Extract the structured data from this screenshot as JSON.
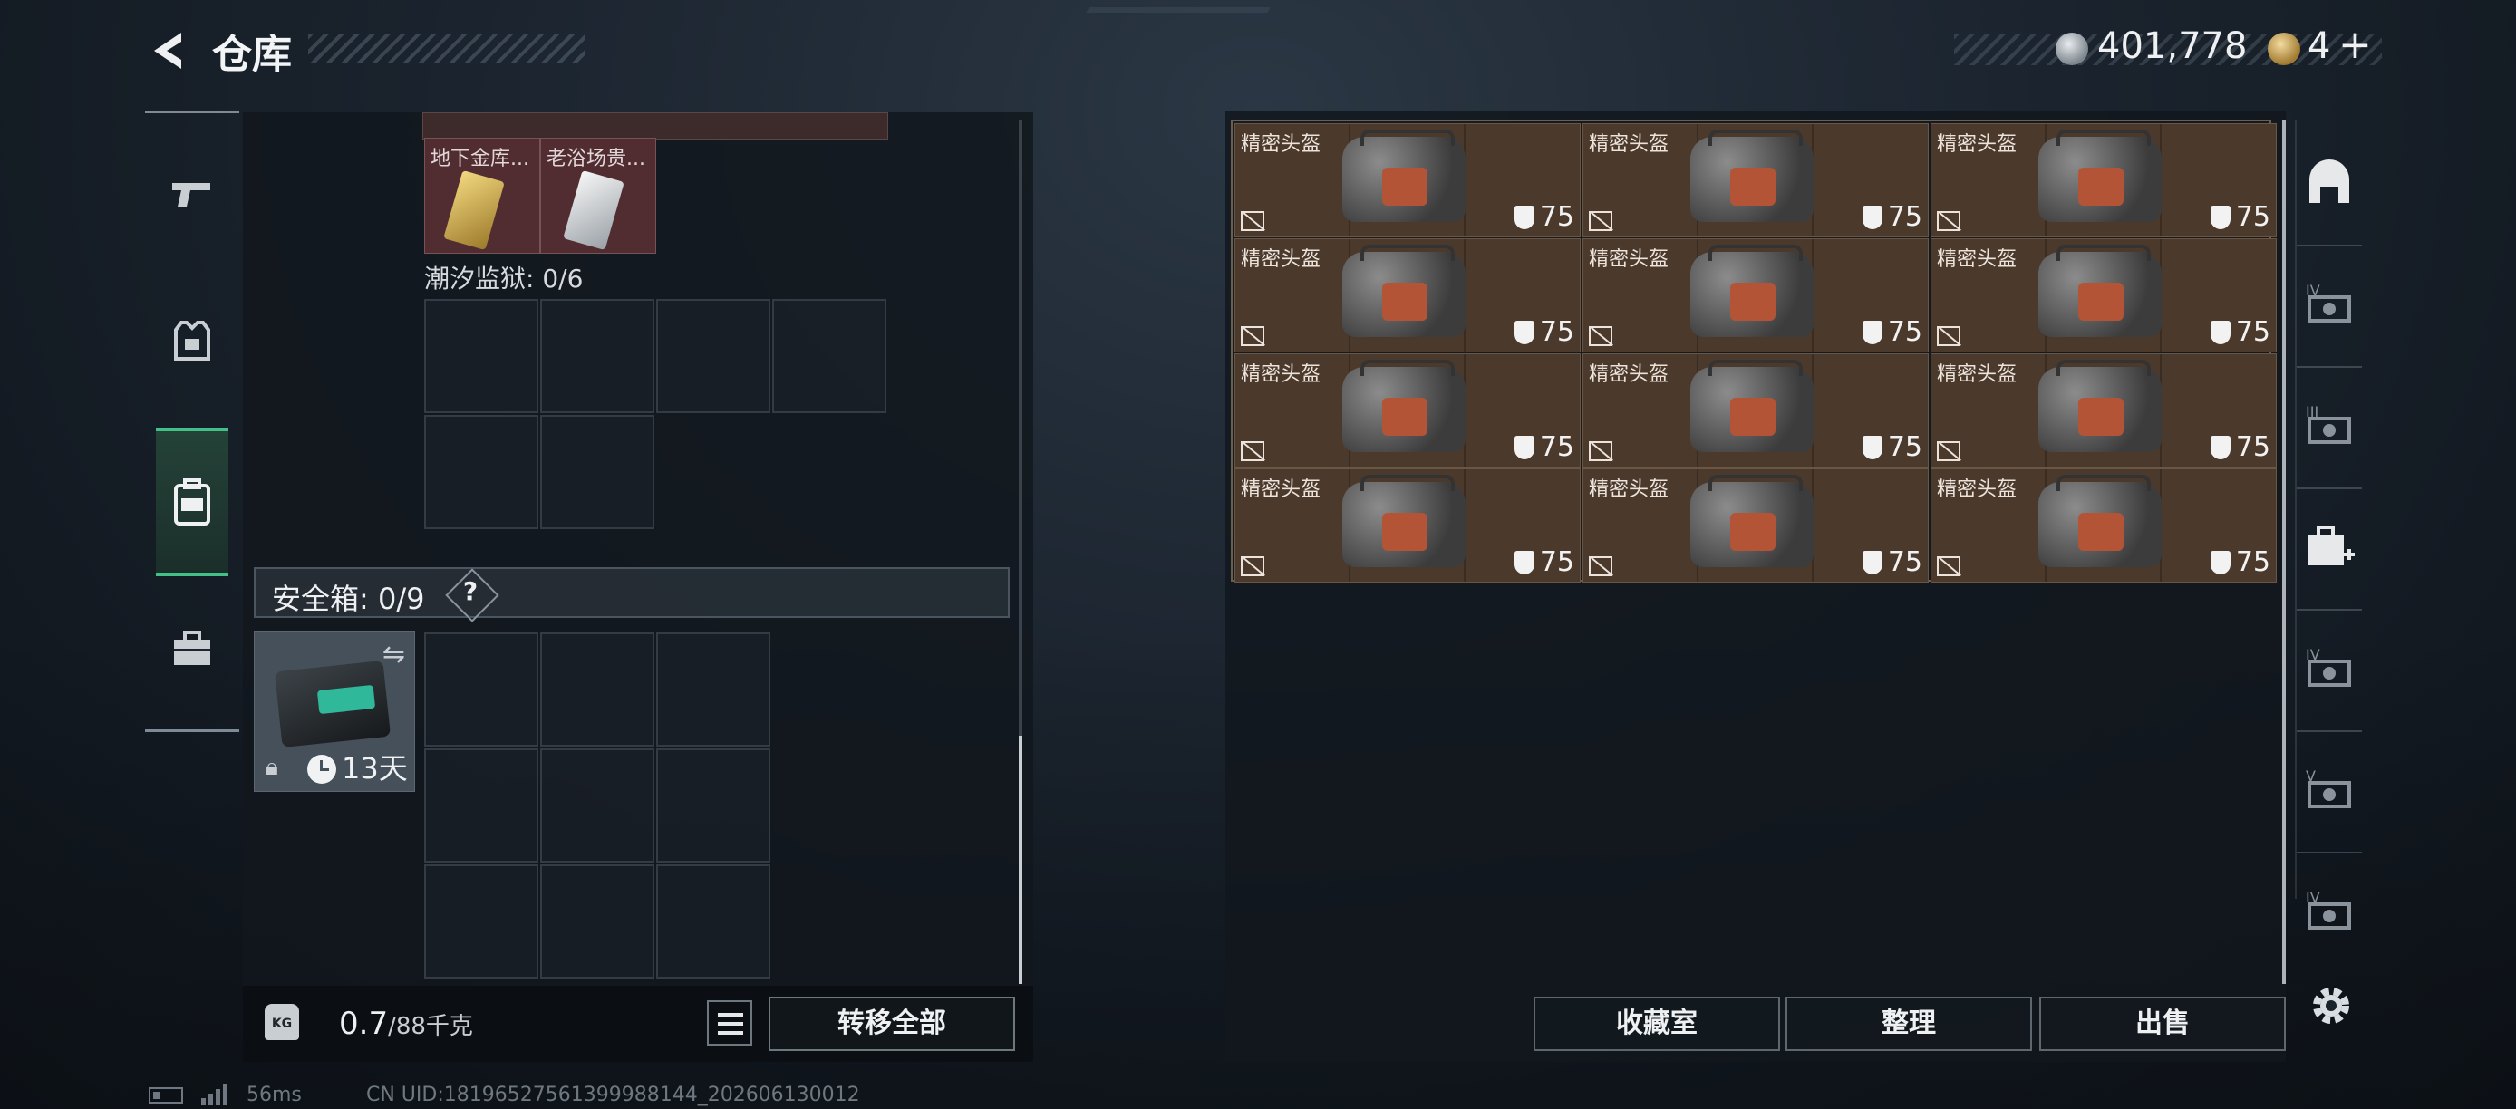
{
  "header": {
    "title": "仓库",
    "silver_currency": "401,778",
    "gold_currency": "4",
    "add_label": "+"
  },
  "left_nav": [
    {
      "icon": "pistol-icon",
      "active": false
    },
    {
      "icon": "vest-icon",
      "active": false
    },
    {
      "icon": "backpack-icon",
      "active": true
    },
    {
      "icon": "toolbox-icon",
      "active": false
    }
  ],
  "backpack": {
    "loot_items": [
      {
        "label": "地下金库..."
      },
      {
        "label": "老浴场贵..."
      }
    ],
    "section_label": "潮汐监狱: 0/6",
    "safe_label": "安全箱: 0/9",
    "safe_help": "?",
    "safebox_timer": "13天"
  },
  "weight": {
    "current": "0.7",
    "max": "/88千克",
    "icon_text": "KG"
  },
  "transfer_all_label": "转移全部",
  "stash": {
    "item_name": "精密头盔",
    "durability": "75",
    "rows": 4,
    "cols": 3
  },
  "actions": {
    "collection": "收藏室",
    "organize": "整理",
    "sell": "出售"
  },
  "right_nav": [
    {
      "icon": "all-stash-icon",
      "tier": ""
    },
    {
      "icon": "weapon-rack-IV-icon",
      "tier": "IV"
    },
    {
      "icon": "weapon-rack-III-icon",
      "tier": "III"
    },
    {
      "icon": "medkit-icon",
      "tier": ""
    },
    {
      "icon": "gear-rack-IV-icon",
      "tier": "IV"
    },
    {
      "icon": "gear-rack-V-icon",
      "tier": "V"
    },
    {
      "icon": "storage-IV-icon",
      "tier": "IV"
    }
  ],
  "status": {
    "ping": "56ms",
    "uid": "CN UID:18196527561399988144_202606130012"
  },
  "colors": {
    "accent_green": "#43c08a",
    "stash_item_bg": "#4b392b",
    "loot_item_bg": "#512d32"
  }
}
